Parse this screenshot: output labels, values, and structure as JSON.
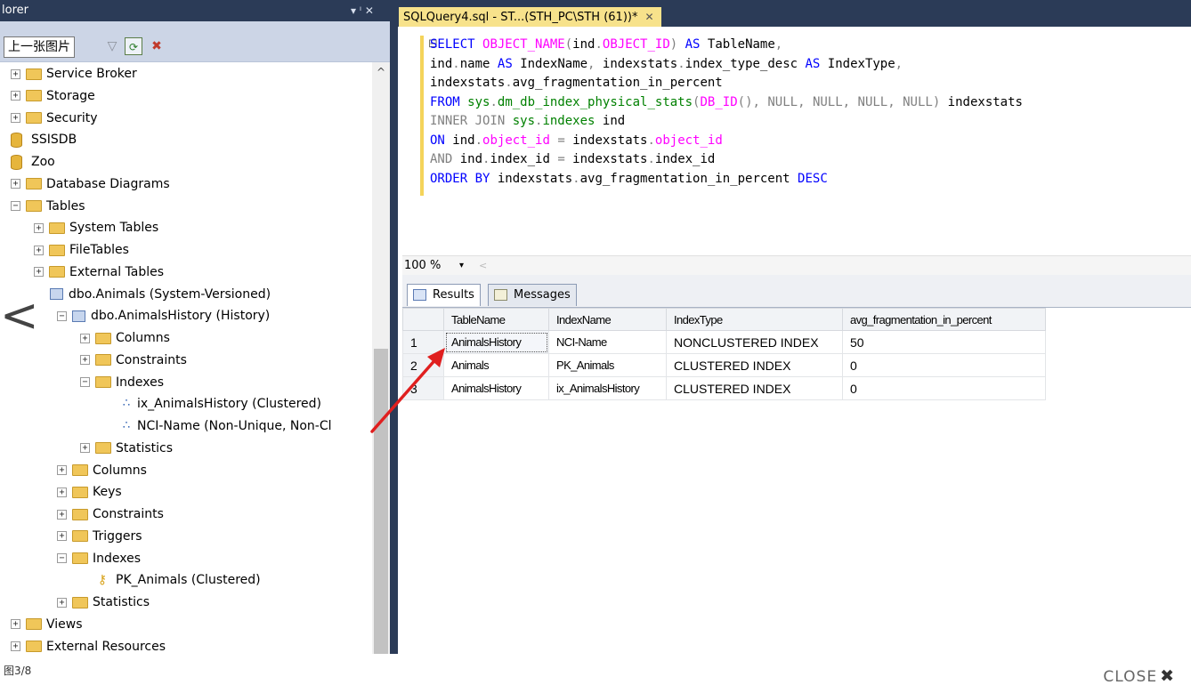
{
  "explorer": {
    "title": "lorer",
    "pin_glyph": "▾ ᴵ ✕",
    "tooltip": "上一张图片",
    "tree": [
      {
        "label": "Service Broker",
        "icon": "folder-icon",
        "expander": "+",
        "indent": 0
      },
      {
        "label": "Storage",
        "icon": "folder-icon",
        "expander": "+",
        "indent": 0
      },
      {
        "label": "Security",
        "icon": "folder-icon",
        "expander": "+",
        "indent": 0
      },
      {
        "label": "SSISDB",
        "icon": "database-icon",
        "expander": "",
        "indent": 0
      },
      {
        "label": "Zoo",
        "icon": "database-icon",
        "expander": "",
        "indent": 0
      },
      {
        "label": "Database Diagrams",
        "icon": "folder-icon",
        "expander": "+",
        "indent": 0
      },
      {
        "label": "Tables",
        "icon": "folder-icon",
        "expander": "−",
        "indent": 0
      },
      {
        "label": "System Tables",
        "icon": "folder-icon",
        "expander": "+",
        "indent": 1
      },
      {
        "label": "FileTables",
        "icon": "folder-icon",
        "expander": "+",
        "indent": 1
      },
      {
        "label": "External Tables",
        "icon": "folder-icon",
        "expander": "+",
        "indent": 1
      },
      {
        "label": "dbo.Animals (System-Versioned)",
        "icon": "table-icon",
        "expander": "",
        "indent": 1
      },
      {
        "label": "dbo.AnimalsHistory (History)",
        "icon": "history-table-icon",
        "expander": "−",
        "indent": 2
      },
      {
        "label": "Columns",
        "icon": "folder-icon",
        "expander": "+",
        "indent": 3
      },
      {
        "label": "Constraints",
        "icon": "folder-icon",
        "expander": "+",
        "indent": 3
      },
      {
        "label": "Indexes",
        "icon": "folder-icon",
        "expander": "−",
        "indent": 3
      },
      {
        "label": "ix_AnimalsHistory (Clustered)",
        "icon": "clustered-index-icon",
        "expander": "",
        "indent": 4
      },
      {
        "label": "NCI-Name (Non-Unique, Non-Cl",
        "icon": "nonclustered-index-icon",
        "expander": "",
        "indent": 4
      },
      {
        "label": "Statistics",
        "icon": "folder-icon",
        "expander": "+",
        "indent": 3
      },
      {
        "label": "Columns",
        "icon": "folder-icon",
        "expander": "+",
        "indent": 2
      },
      {
        "label": "Keys",
        "icon": "folder-icon",
        "expander": "+",
        "indent": 2
      },
      {
        "label": "Constraints",
        "icon": "folder-icon",
        "expander": "+",
        "indent": 2
      },
      {
        "label": "Triggers",
        "icon": "folder-icon",
        "expander": "+",
        "indent": 2
      },
      {
        "label": "Indexes",
        "icon": "folder-icon",
        "expander": "−",
        "indent": 2
      },
      {
        "label": "PK_Animals (Clustered)",
        "icon": "key-icon",
        "expander": "",
        "indent": 3
      },
      {
        "label": "Statistics",
        "icon": "folder-icon",
        "expander": "+",
        "indent": 2
      },
      {
        "label": "Views",
        "icon": "folder-icon",
        "expander": "+",
        "indent": 0
      },
      {
        "label": "External Resources",
        "icon": "folder-icon",
        "expander": "+",
        "indent": 0
      }
    ]
  },
  "editor": {
    "tab_label": "SQLQuery4.sql - ST...(STH_PC\\STH (61))*",
    "tab_close": "✕",
    "collapse_glyph": "⊟",
    "code": [
      [
        [
          "kw",
          "SELECT "
        ],
        [
          "fn",
          "OBJECT_NAME"
        ],
        [
          "gr",
          "("
        ],
        [
          "plain",
          "ind"
        ],
        [
          "gr",
          "."
        ],
        [
          "fn",
          "OBJECT_ID"
        ],
        [
          "gr",
          ")"
        ],
        [
          "kw",
          " AS "
        ],
        [
          "plain",
          "TableName"
        ],
        [
          "gr",
          ","
        ]
      ],
      [
        [
          "plain",
          "ind"
        ],
        [
          "gr",
          "."
        ],
        [
          "plain",
          "name "
        ],
        [
          "kw",
          "AS "
        ],
        [
          "plain",
          "IndexName"
        ],
        [
          "gr",
          ", "
        ],
        [
          "plain",
          "indexstats"
        ],
        [
          "gr",
          "."
        ],
        [
          "plain",
          "index_type_desc "
        ],
        [
          "kw",
          "AS "
        ],
        [
          "plain",
          "IndexType"
        ],
        [
          "gr",
          ","
        ]
      ],
      [
        [
          "plain",
          "indexstats"
        ],
        [
          "gr",
          "."
        ],
        [
          "plain",
          "avg_fragmentation_in_percent"
        ]
      ],
      [
        [
          "kw",
          "FROM "
        ],
        [
          "sys",
          "sys"
        ],
        [
          "gr",
          "."
        ],
        [
          "sys",
          "dm_db_index_physical_stats"
        ],
        [
          "gr",
          "("
        ],
        [
          "fn",
          "DB_ID"
        ],
        [
          "gr",
          "(), "
        ],
        [
          "gr",
          "NULL"
        ],
        [
          "gr",
          ", "
        ],
        [
          "gr",
          "NULL"
        ],
        [
          "gr",
          ", "
        ],
        [
          "gr",
          "NULL"
        ],
        [
          "gr",
          ", "
        ],
        [
          "gr",
          "NULL"
        ],
        [
          "gr",
          ") "
        ],
        [
          "plain",
          "indexstats"
        ]
      ],
      [
        [
          "gr",
          "INNER JOIN "
        ],
        [
          "sys",
          "sys"
        ],
        [
          "gr",
          "."
        ],
        [
          "sys",
          "indexes "
        ],
        [
          "plain",
          "ind"
        ]
      ],
      [
        [
          "kw",
          "ON "
        ],
        [
          "plain",
          "ind"
        ],
        [
          "gr",
          "."
        ],
        [
          "fn",
          "object_id "
        ],
        [
          "gr",
          "= "
        ],
        [
          "plain",
          "indexstats"
        ],
        [
          "gr",
          "."
        ],
        [
          "fn",
          "object_id"
        ]
      ],
      [
        [
          "gr",
          "AND "
        ],
        [
          "plain",
          "ind"
        ],
        [
          "gr",
          "."
        ],
        [
          "plain",
          "index_id "
        ],
        [
          "gr",
          "= "
        ],
        [
          "plain",
          "indexstats"
        ],
        [
          "gr",
          "."
        ],
        [
          "plain",
          "index_id"
        ]
      ],
      [
        [
          "kw",
          "ORDER BY "
        ],
        [
          "plain",
          "indexstats"
        ],
        [
          "gr",
          "."
        ],
        [
          "plain",
          "avg_fragmentation_in_percent "
        ],
        [
          "kw",
          "DESC"
        ]
      ]
    ],
    "zoom_level": "100 %",
    "zoom_dropdown": "▾",
    "zoom_left": "<"
  },
  "results": {
    "tab_results": "Results",
    "tab_messages": "Messages",
    "columns": [
      "TableName",
      "IndexName",
      "IndexType",
      "avg_fragmentation_in_percent"
    ],
    "rows": [
      {
        "num": "1",
        "cells": [
          "AnimalsHistory",
          "NCI-Name",
          "NONCLUSTERED INDEX",
          "50"
        ]
      },
      {
        "num": "2",
        "cells": [
          "Animals",
          "PK_Animals",
          "CLUSTERED INDEX",
          "0"
        ]
      },
      {
        "num": "3",
        "cells": [
          "AnimalsHistory",
          "ix_AnimalsHistory",
          "CLUSTERED INDEX",
          "0"
        ]
      }
    ]
  },
  "viewer": {
    "counter": "图3/8",
    "close_label": "CLOSE",
    "close_glyph": "✖",
    "back_glyph": "<"
  },
  "colors": {
    "title_bar": "#2b3b57",
    "tab_active": "#f7e28b",
    "keyword": "#0000ff",
    "function": "#ff00ff",
    "system_object": "#008000",
    "operator": "#808080",
    "annotation_arrow": "#e01f1f"
  }
}
